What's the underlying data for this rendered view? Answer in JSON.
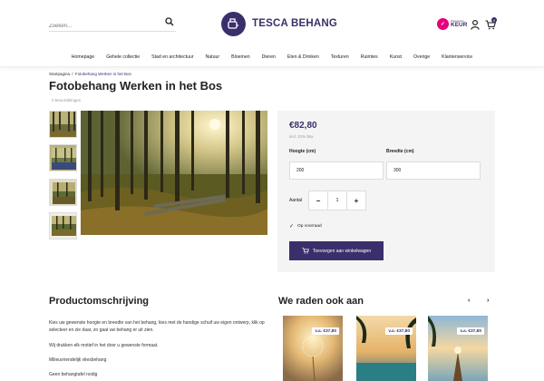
{
  "header": {
    "search_placeholder": "Zoeken...",
    "logo_text": "TESCA BEHANG",
    "keur_small": "Webwinkel",
    "keur_big": "KEUR",
    "cart_count": "0"
  },
  "nav": {
    "items": [
      "Homepage",
      "Gehele collectie",
      "Stad en architectuur",
      "Natuur",
      "Bloemen",
      "Dieren",
      "Eten & Drinken",
      "Texturen",
      "Ruimtes",
      "Kunst",
      "Overige",
      "Klantenservice"
    ]
  },
  "breadcrumb": {
    "home": "Startpagina",
    "separator": "/",
    "current": "Fotobehang Werken in het Bos"
  },
  "product": {
    "title": "Fotobehang Werken in het Bos",
    "reviews": "0 beoordelingen",
    "price": "€82,80",
    "vat": "incl. 21% btw",
    "height_label": "Hoogte (cm)",
    "height_value": "200",
    "width_label": "Breedte (cm)",
    "width_value": "300",
    "qty_label": "Aantal",
    "qty_minus": "−",
    "qty_value": "1",
    "qty_plus": "+",
    "stock": "Op voorraad",
    "add_to_cart": "Toevoegen aan winkelwagen"
  },
  "description": {
    "title": "Productomschrijving",
    "p1": "Kies uw gewenste hoogte en breedte van het behang, kies met de handige schuif uw eigen ontwerp, klik op selecteer en zie daar, zo gaat uw behang er uit zien.",
    "p2": "Wij drukken elk motief in het door u gewenste formaat.",
    "p3": "Milieuvriendelijk vliesbehang",
    "p4": "Geen behangtafel nodig"
  },
  "recommendations": {
    "title": "We raden ook aan",
    "prev": "‹",
    "next": "›",
    "cards": [
      {
        "price": "v.a. €37,80"
      },
      {
        "price": "v.a. €37,80"
      },
      {
        "price": "v.a. €37,80"
      }
    ]
  },
  "colors": {
    "brand": "#3b2f6b",
    "panel_bg": "#f4f4f4"
  }
}
